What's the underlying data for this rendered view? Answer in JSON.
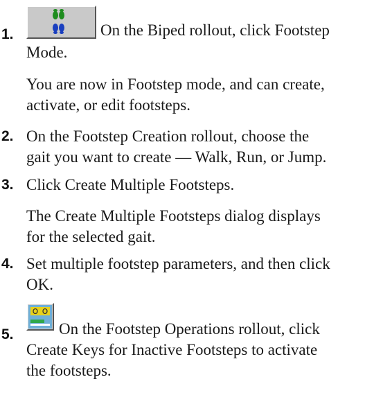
{
  "steps": [
    {
      "number": "1.",
      "icon": "footstep-mode-icon",
      "lines": [
        "On the Biped rollout, click Footstep",
        "Mode."
      ],
      "note": [
        "You are now in Footstep mode, and can create,",
        "activate, or edit footsteps."
      ]
    },
    {
      "number": "2.",
      "lines": [
        "On the Footstep Creation rollout, choose the",
        "gait you want to create — Walk, Run, or Jump."
      ]
    },
    {
      "number": "3.",
      "lines": [
        "Click Create Multiple Footsteps."
      ],
      "note": [
        "The Create Multiple Footsteps dialog displays",
        "for the selected gait."
      ]
    },
    {
      "number": "4.",
      "lines": [
        "Set multiple footstep parameters, and then click",
        "OK."
      ]
    },
    {
      "number": "5.",
      "icon": "create-keys-inactive-footsteps-icon",
      "lines": [
        "On the Footstep Operations rollout, click",
        "Create Keys for Inactive Footsteps to activate",
        "the footsteps."
      ]
    }
  ],
  "colors": {
    "footstep_green": "#1e8c1e",
    "footstep_blue": "#1a3fbf",
    "icon_yellow": "#e8d21a",
    "button_face": "#c9c9c9"
  }
}
